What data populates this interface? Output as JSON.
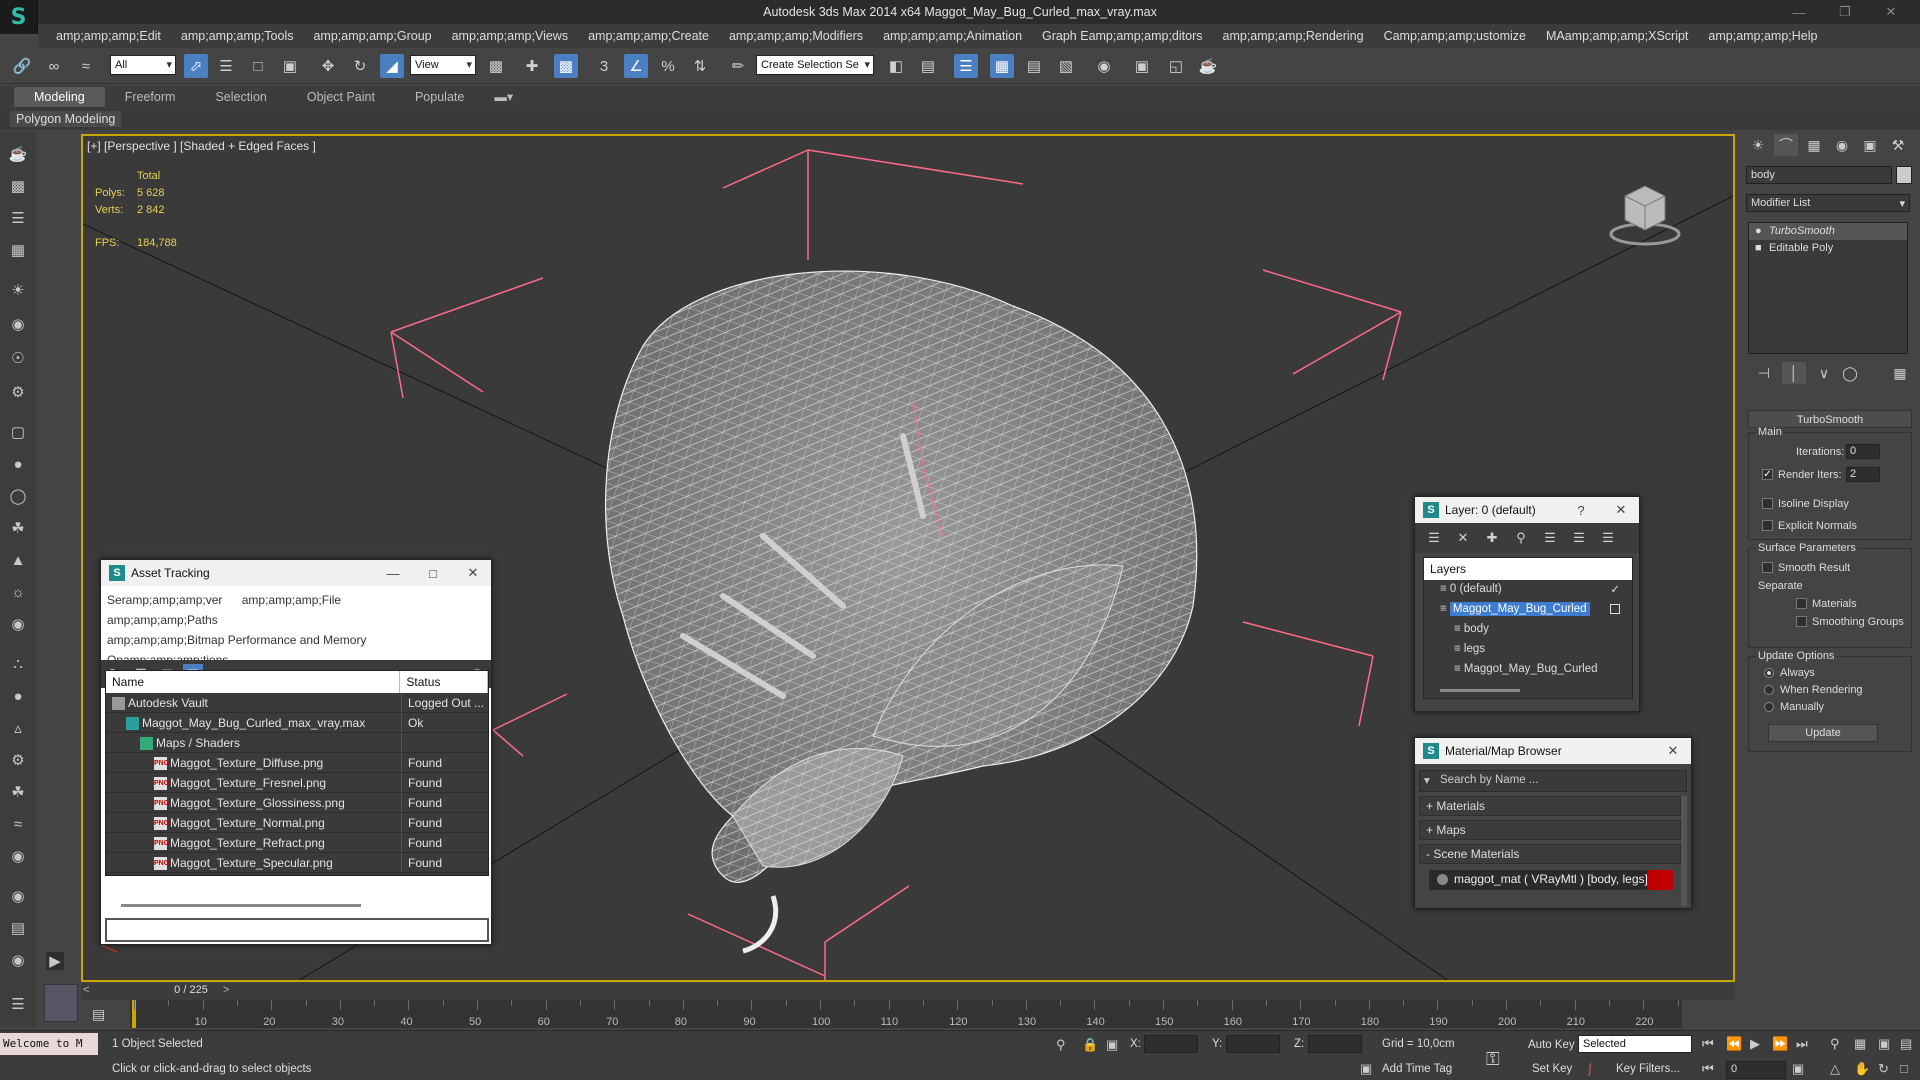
{
  "window": {
    "title": "Autodesk 3ds Max  2014 x64    Maggot_May_Bug_Curled_max_vray.max"
  },
  "menu": [
    "amp;amp;amp;Edit",
    "amp;amp;amp;Tools",
    "amp;amp;amp;Group",
    "amp;amp;amp;Views",
    "amp;amp;amp;Create",
    "amp;amp;amp;Modifiers",
    "amp;amp;amp;Animation",
    "Graph Eamp;amp;amp;ditors",
    "amp;amp;amp;Rendering",
    "Camp;amp;amp;ustomize",
    "MAamp;amp;amp;XScript",
    "amp;amp;amp;Help"
  ],
  "toolbar": {
    "selection_filter": "All",
    "coord_system": "View",
    "selection_set_placeholder": "Create Selection Se"
  },
  "ribbon": {
    "tabs": [
      "Modeling",
      "Freeform",
      "Selection",
      "Object Paint",
      "Populate"
    ],
    "panel_label": "Polygon Modeling"
  },
  "viewport": {
    "label": "[+] [Perspective ] [Shaded + Edged Faces ]",
    "stats": {
      "total_label": "Total",
      "polys_label": "Polys:",
      "polys_value": "5 628",
      "verts_label": "Verts:",
      "verts_value": "2 842",
      "fps_label": "FPS:",
      "fps_value": "184,788"
    }
  },
  "asset_tracking": {
    "title": "Asset Tracking",
    "menus": [
      "Seramp;amp;amp;ver",
      "amp;amp;amp;File",
      "amp;amp;amp;Paths",
      "amp;amp;amp;Bitmap Performance and Memory",
      "Opamp;amp;amp;tions"
    ],
    "columns": [
      "Name",
      "Status"
    ],
    "rows": [
      {
        "name": "Autodesk Vault",
        "status": "Logged Out ...",
        "level": 0
      },
      {
        "name": "Maggot_May_Bug_Curled_max_vray.max",
        "status": "Ok",
        "level": 1
      },
      {
        "name": "Maps / Shaders",
        "status": "",
        "level": 2
      },
      {
        "name": "Maggot_Texture_Diffuse.png",
        "status": "Found",
        "level": 3
      },
      {
        "name": "Maggot_Texture_Fresnel.png",
        "status": "Found",
        "level": 3
      },
      {
        "name": "Maggot_Texture_Glossiness.png",
        "status": "Found",
        "level": 3
      },
      {
        "name": "Maggot_Texture_Normal.png",
        "status": "Found",
        "level": 3
      },
      {
        "name": "Maggot_Texture_Refract.png",
        "status": "Found",
        "level": 3
      },
      {
        "name": "Maggot_Texture_Specular.png",
        "status": "Found",
        "level": 3
      }
    ]
  },
  "layer_dialog": {
    "title": "Layer: 0 (default)",
    "header": "Layers",
    "rows": [
      {
        "name": "0 (default)",
        "level": 0,
        "selected": false
      },
      {
        "name": "Maggot_May_Bug_Curled",
        "level": 0,
        "selected": true
      },
      {
        "name": "body",
        "level": 1,
        "selected": false
      },
      {
        "name": "legs",
        "level": 1,
        "selected": false
      },
      {
        "name": "Maggot_May_Bug_Curled",
        "level": 1,
        "selected": false
      }
    ]
  },
  "material_browser": {
    "title": "Material/Map Browser",
    "search_placeholder": "Search by Name ...",
    "groups": [
      "+ Materials",
      "+ Maps",
      "- Scene Materials"
    ],
    "scene_material": "maggot_mat  ( VRayMtl ) [body, legs]"
  },
  "command_panel": {
    "object_name": "body",
    "modifier_list": "Modifier List",
    "stack": [
      "TurboSmooth",
      "Editable Poly"
    ],
    "rollout_title": "TurboSmooth",
    "main_label": "Main",
    "iterations_label": "Iterations:",
    "iterations_value": "0",
    "render_iters_label": "Render Iters:",
    "render_iters_value": "2",
    "isoline_label": "Isoline Display",
    "explicit_normals_label": "Explicit Normals",
    "surface_params_label": "Surface Parameters",
    "smooth_result_label": "Smooth Result",
    "separate_label": "Separate",
    "materials_label": "Materials",
    "smoothing_groups_label": "Smoothing Groups",
    "update_options_label": "Update Options",
    "always_label": "Always",
    "when_rendering_label": "When Rendering",
    "manually_label": "Manually",
    "update_button": "Update"
  },
  "timeline": {
    "frame_display": "0 / 225",
    "ticks": [
      "10",
      "20",
      "30",
      "40",
      "50",
      "60",
      "70",
      "80",
      "90",
      "100",
      "110",
      "120",
      "130",
      "140",
      "150",
      "160",
      "170",
      "180",
      "190",
      "200",
      "210",
      "220"
    ]
  },
  "status": {
    "maxscript": "Welcome to M",
    "selected": "1 Object Selected",
    "prompt": "Click or click-and-drag to select objects",
    "x_label": "X:",
    "y_label": "Y:",
    "z_label": "Z:",
    "grid": "Grid = 10,0cm",
    "add_time_tag": "Add Time Tag",
    "auto_key": "Auto Key",
    "set_key": "Set Key",
    "key_mode": "Selected",
    "key_filters": "Key Filters...",
    "frame_field": "0"
  }
}
